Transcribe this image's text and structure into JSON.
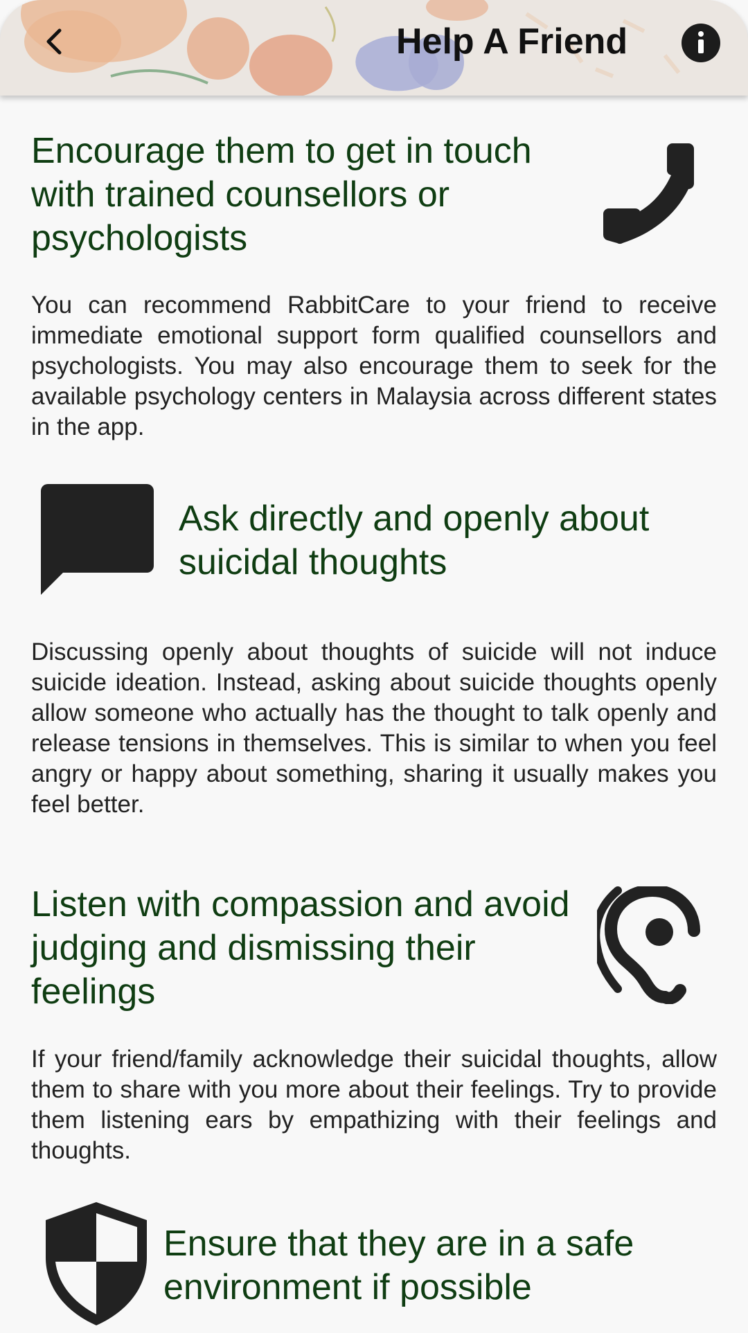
{
  "header": {
    "title": "Help A Friend",
    "back_icon": "chevron-left-icon",
    "info_icon": "info-icon"
  },
  "sections": [
    {
      "icon": "phone-icon",
      "title": "Encourage them to get in touch with trained counsellors or psychologists",
      "body": "You can recommend RabbitCare to your friend to receive immediate emotional support form qualified counsellors and psychologists. You may also encourage them to seek for the available psychology centers in Malaysia across different states in the app."
    },
    {
      "icon": "chat-bubble-icon",
      "title": "Ask directly and openly about suicidal thoughts",
      "body": "Discussing openly about thoughts of suicide will not induce suicide ideation. Instead, asking about suicide thoughts openly allow someone who actually has the thought to talk openly and release tensions in themselves. This is similar to when you feel angry or happy about something, sharing it usually makes you feel better."
    },
    {
      "icon": "ear-icon",
      "title": "Listen with compassion and avoid judging and dismissing their feelings",
      "body": "If your friend/family acknowledge their suicidal thoughts, allow them to share with you more about their feelings. Try to provide them listening ears by empathizing with their feelings and thoughts."
    },
    {
      "icon": "shield-icon",
      "title": "Ensure that they are in a safe environment if possible"
    }
  ],
  "colors": {
    "title_green": "#0f3d12",
    "icon_dark": "#222222",
    "background": "#f8f8f8"
  }
}
